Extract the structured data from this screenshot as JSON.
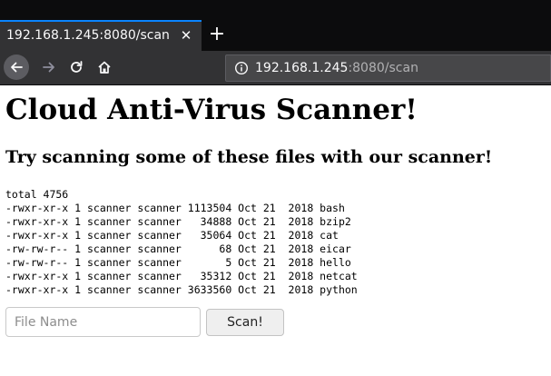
{
  "browser": {
    "tab_title": "192.168.1.245:8080/scan",
    "url_host": "192.168.1.245",
    "url_rest": ":8080/scan",
    "icons": {
      "tab_close": "close-icon",
      "new_tab": "plus-icon",
      "back": "arrow-left-icon",
      "forward": "arrow-right-icon",
      "reload": "reload-icon",
      "home": "home-icon",
      "site_info": "info-icon"
    },
    "accent_color": "#0a84ff"
  },
  "page": {
    "title": "Cloud Anti-Virus Scanner!",
    "subtitle": "Try scanning some of these files with our scanner!",
    "listing": [
      "total 4756",
      "-rwxr-xr-x 1 scanner scanner 1113504 Oct 21  2018 bash",
      "-rwxr-xr-x 1 scanner scanner   34888 Oct 21  2018 bzip2",
      "-rwxr-xr-x 1 scanner scanner   35064 Oct 21  2018 cat",
      "-rw-rw-r-- 1 scanner scanner      68 Oct 21  2018 eicar",
      "-rw-rw-r-- 1 scanner scanner       5 Oct 21  2018 hello",
      "-rwxr-xr-x 1 scanner scanner   35312 Oct 21  2018 netcat",
      "-rwxr-xr-x 1 scanner scanner 3633560 Oct 21  2018 python"
    ],
    "form": {
      "file_name_value": "",
      "file_name_placeholder": "File Name",
      "scan_label": "Scan!"
    }
  }
}
